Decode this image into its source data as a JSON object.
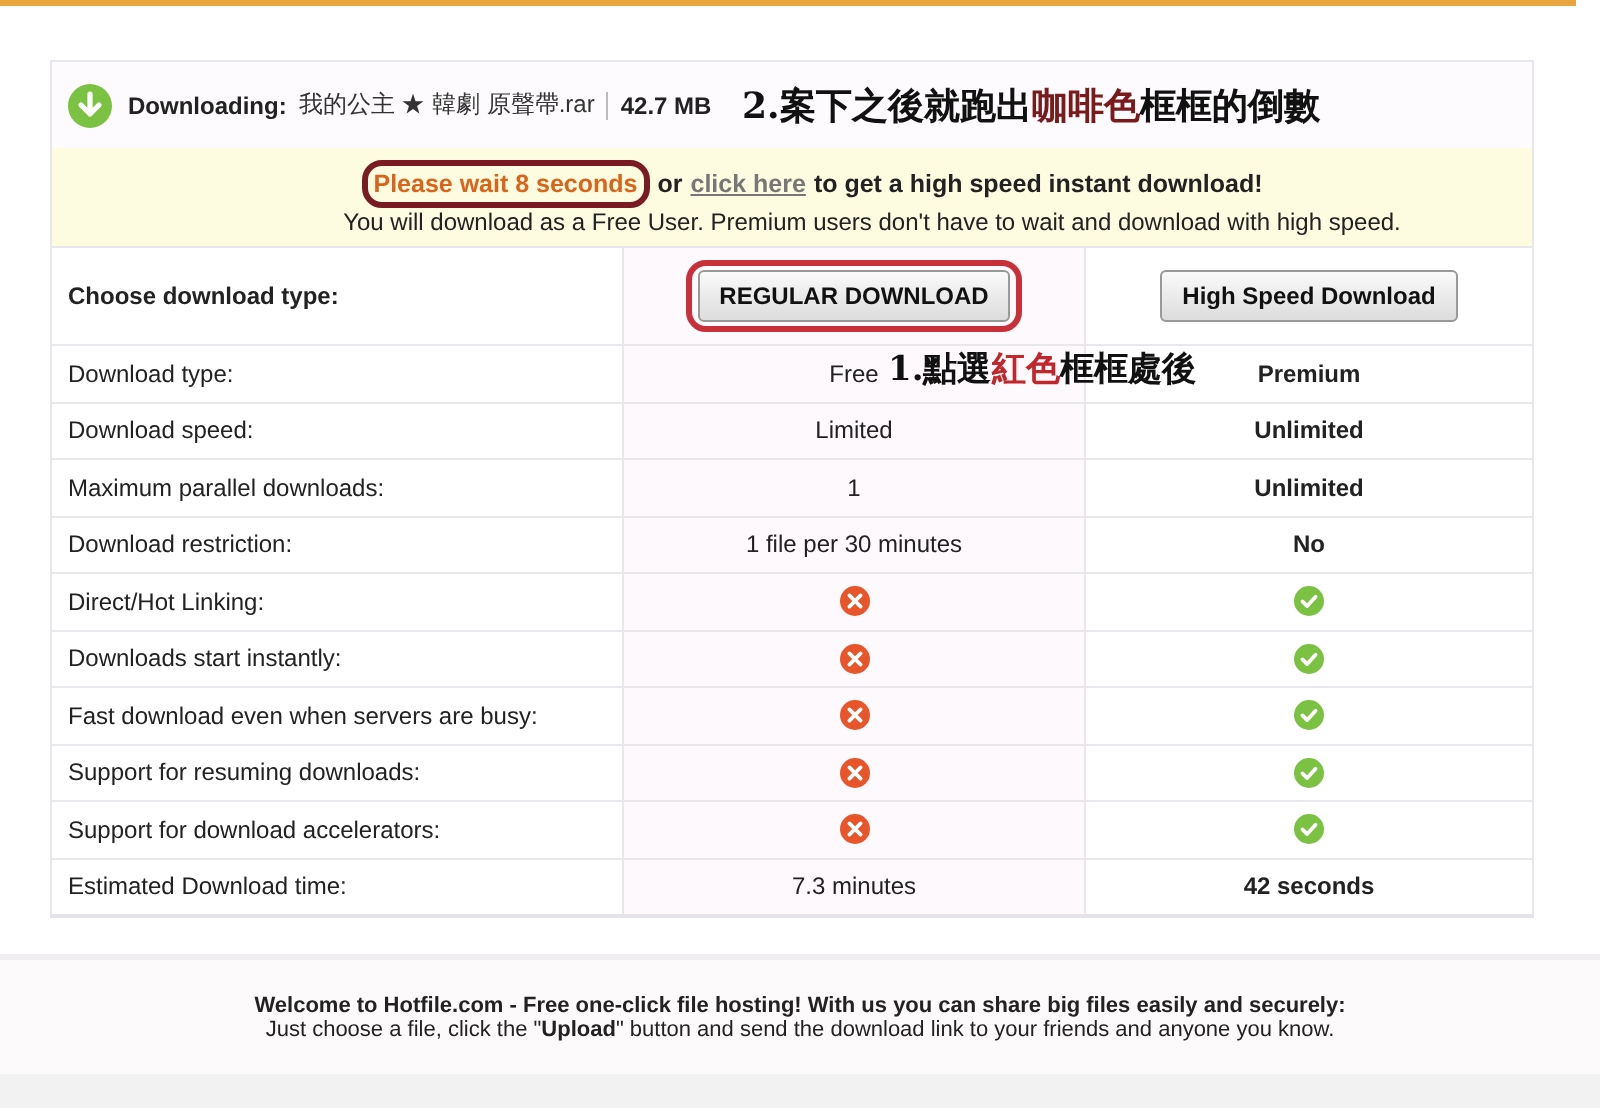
{
  "download": {
    "label": "Downloading:",
    "filename": "我的公主 ★ 韓劇 原聲帶.rar",
    "size": "42.7 MB"
  },
  "notice": {
    "wait": "Please wait 8 seconds",
    "wait_highlighted": true,
    "or": "or",
    "link": "click here",
    "rest": "to get a high speed instant download!",
    "line2": "You will download as a Free User. Premium users don't have to wait and download with high speed."
  },
  "choose": {
    "label": "Choose download type:",
    "buttons": [
      {
        "label": "REGULAR DOWNLOAD",
        "highlighted": true
      },
      {
        "label": "High Speed Download",
        "highlighted": false
      }
    ]
  },
  "rows": [
    {
      "label": "Download type:",
      "free": {
        "kind": "text",
        "text": "Free"
      },
      "premium": {
        "kind": "text",
        "text": "Premium"
      }
    },
    {
      "label": "Download speed:",
      "free": {
        "kind": "text",
        "text": "Limited"
      },
      "premium": {
        "kind": "text",
        "text": "Unlimited"
      }
    },
    {
      "label": "Maximum parallel downloads:",
      "free": {
        "kind": "text",
        "text": "1"
      },
      "premium": {
        "kind": "text",
        "text": "Unlimited"
      }
    },
    {
      "label": "Download restriction:",
      "free": {
        "kind": "text",
        "text": "1 file per 30 minutes"
      },
      "premium": {
        "kind": "text",
        "text": "No"
      }
    },
    {
      "label": "Direct/Hot Linking:",
      "free": {
        "kind": "no"
      },
      "premium": {
        "kind": "yes"
      }
    },
    {
      "label": "Downloads start instantly:",
      "free": {
        "kind": "no"
      },
      "premium": {
        "kind": "yes"
      }
    },
    {
      "label": "Fast download even when servers are busy:",
      "free": {
        "kind": "no"
      },
      "premium": {
        "kind": "yes"
      }
    },
    {
      "label": "Support for resuming downloads:",
      "free": {
        "kind": "no"
      },
      "premium": {
        "kind": "yes"
      }
    },
    {
      "label": "Support for download accelerators:",
      "free": {
        "kind": "no"
      },
      "premium": {
        "kind": "yes"
      }
    },
    {
      "label": "Estimated Download time:",
      "free": {
        "kind": "text",
        "text": "7.3 minutes"
      },
      "premium": {
        "kind": "text",
        "text": "42 seconds"
      }
    }
  ],
  "annotations": [
    {
      "parts": [
        {
          "text": "2.案下之後就跑出",
          "color": "#111111"
        },
        {
          "text": "咖啡色",
          "color": "#7a1a1a"
        },
        {
          "text": "框框的倒數",
          "color": "#111111"
        }
      ]
    },
    {
      "parts": [
        {
          "text": "1.點選",
          "color": "#111111"
        },
        {
          "text": "紅色",
          "color": "#c0262a"
        },
        {
          "text": "框框處後",
          "color": "#111111"
        }
      ]
    }
  ],
  "footer": {
    "title": "Welcome to Hotfile.com - Free one-click file hosting! With us you can share big files easily and securely:",
    "line": "Just choose a file, click the \"**Upload**\" button and send the download link to your friends and anyone you know."
  }
}
